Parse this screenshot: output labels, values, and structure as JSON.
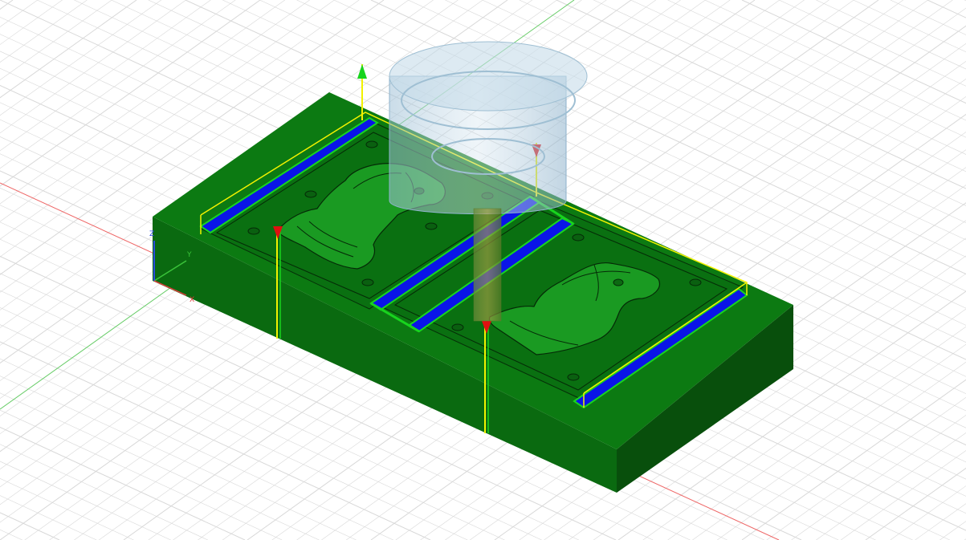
{
  "viewport": {
    "background": "#ffffff",
    "grid_color": "#d8d8d8",
    "grid_major_color": "#c4c4c4"
  },
  "colors": {
    "stock_top": "#0c7a12",
    "stock_front": "#0a6a10",
    "stock_side": "#084f0c",
    "pocket_floor": "#0d8a14",
    "relief": "#1a9a22",
    "toolpath_blue": "#0a14e8",
    "toolpath_green": "#18d41e",
    "boundary_yellow": "#f2f200",
    "tool_holder": "#a9c9dc",
    "x_axis": "#e03a3a",
    "y_axis": "#3ac33a",
    "z_axis": "#2a4ae0"
  },
  "triad": {
    "x_label": "X",
    "y_label": "Y",
    "z_label": "Z"
  },
  "icons": {
    "triad": "xyz-triad-icon",
    "tool": "endmill-tool-icon",
    "arrow": "entry-arrow-icon"
  }
}
